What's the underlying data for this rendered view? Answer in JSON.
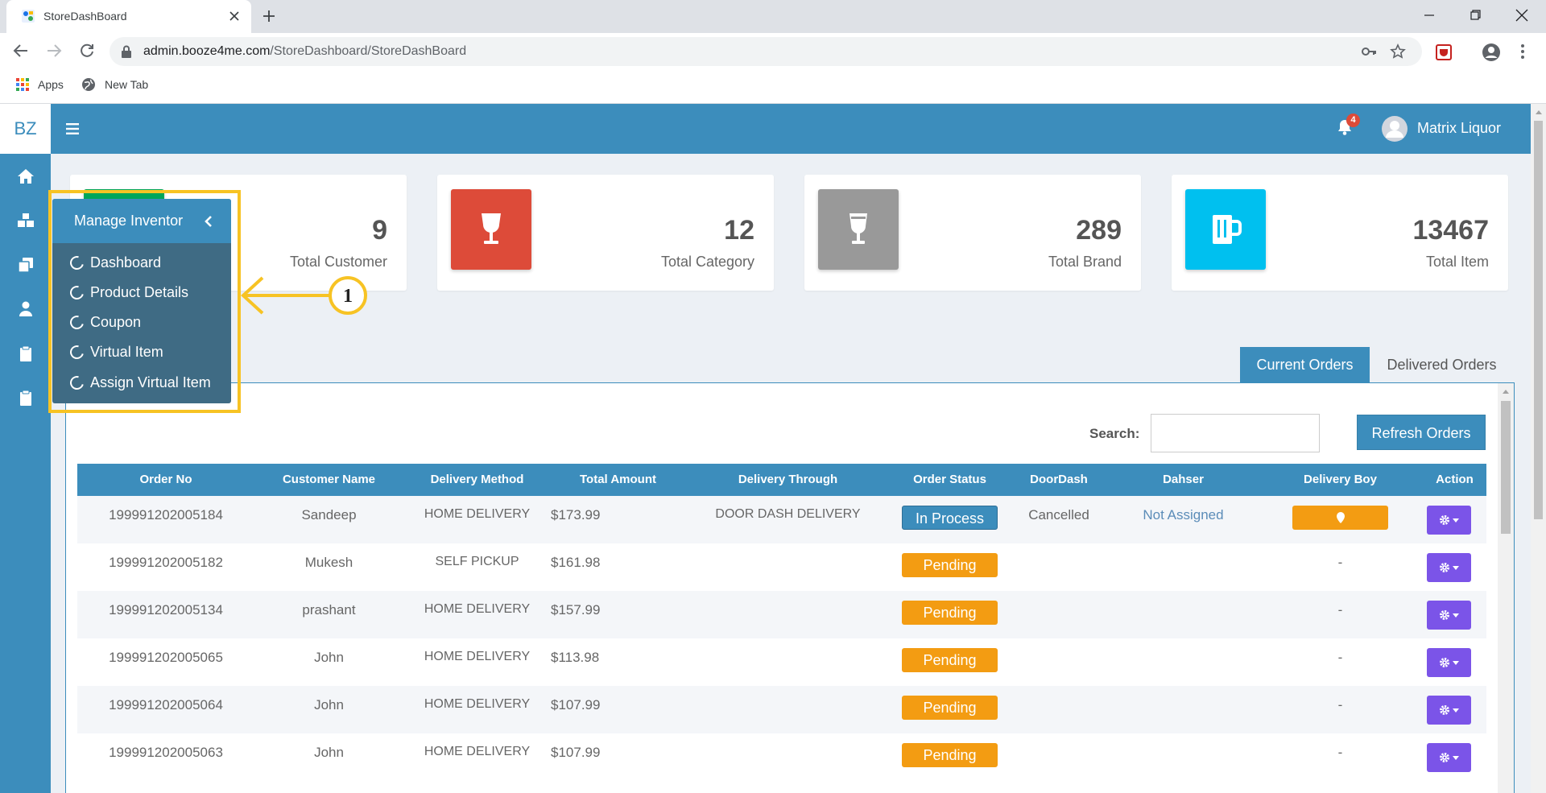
{
  "browser": {
    "tab_title": "StoreDashBoard",
    "url_host": "admin.booze4me.com",
    "url_path": "/StoreDashboard/StoreDashBoard",
    "bookmarks": [
      {
        "label": "Apps"
      },
      {
        "label": "New Tab"
      }
    ]
  },
  "app": {
    "logo": "BZ",
    "notification_count": "4",
    "user_name": "Matrix Liquor",
    "sidebar_icons": [
      "home-icon",
      "cubes-icon",
      "clone-icon",
      "user-icon",
      "clipboard-icon",
      "clipboard-icon"
    ]
  },
  "stats": [
    {
      "value": "9",
      "label": "Total Customer",
      "color": "#00a65a"
    },
    {
      "value": "12",
      "label": "Total Category",
      "color": "#dd4b39"
    },
    {
      "value": "289",
      "label": "Total Brand",
      "color": "#999999"
    },
    {
      "value": "13467",
      "label": "Total Item",
      "color": "#00c0ef"
    }
  ],
  "flyout": {
    "title": "Manage Inventory",
    "items": [
      "Dashboard",
      "Product Details",
      "Coupon",
      "Virtual Item",
      "Assign Virtual Item"
    ]
  },
  "callout": {
    "number": "1",
    "color": "#f7c324"
  },
  "orders": {
    "tabs": {
      "current": "Current Orders",
      "delivered": "Delivered Orders"
    },
    "search_label": "Search:",
    "search_value": "",
    "refresh_label": "Refresh Orders",
    "columns": [
      "Order No",
      "Customer Name",
      "Delivery Method",
      "Total Amount",
      "Delivery Through",
      "Order Status",
      "DoorDash",
      "Dahser",
      "Delivery Boy",
      "Action"
    ],
    "rows": [
      {
        "order_no": "199991202005184",
        "customer": "Sandeep",
        "method": "HOME DELIVERY",
        "amount": "$173.99",
        "through": "DOOR DASH DELIVERY",
        "status": "In Process",
        "doordash": "Cancelled",
        "dasher": "Not Assigned",
        "boy": ""
      },
      {
        "order_no": "199991202005182",
        "customer": "Mukesh",
        "method": "SELF PICKUP",
        "amount": "$161.98",
        "through": "",
        "status": "Pending",
        "doordash": "",
        "dasher": "",
        "boy": "-"
      },
      {
        "order_no": "199991202005134",
        "customer": "prashant",
        "method": "HOME DELIVERY",
        "amount": "$157.99",
        "through": "",
        "status": "Pending",
        "doordash": "",
        "dasher": "",
        "boy": "-"
      },
      {
        "order_no": "199991202005065",
        "customer": "John",
        "method": "HOME DELIVERY",
        "amount": "$113.98",
        "through": "",
        "status": "Pending",
        "doordash": "",
        "dasher": "",
        "boy": "-"
      },
      {
        "order_no": "199991202005064",
        "customer": "John",
        "method": "HOME DELIVERY",
        "amount": "$107.99",
        "through": "",
        "status": "Pending",
        "doordash": "",
        "dasher": "",
        "boy": "-"
      },
      {
        "order_no": "199991202005063",
        "customer": "John",
        "method": "HOME DELIVERY",
        "amount": "$107.99",
        "through": "",
        "status": "Pending",
        "doordash": "",
        "dasher": "",
        "boy": "-"
      }
    ]
  }
}
